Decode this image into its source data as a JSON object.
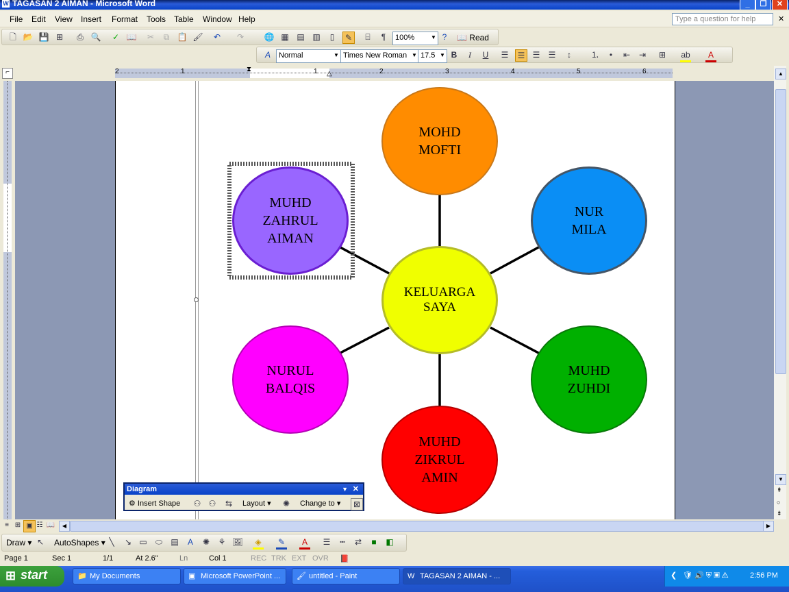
{
  "window": {
    "title": "TAGASAN 2 AIMAN - Microsoft Word"
  },
  "menu": [
    "File",
    "Edit",
    "View",
    "Insert",
    "Format",
    "Tools",
    "Table",
    "Window",
    "Help"
  ],
  "help_placeholder": "Type a question for help",
  "standard_toolbar": {
    "zoom": "100%",
    "read_label": "Read"
  },
  "formatting_toolbar": {
    "style": "Normal",
    "font": "Times New Roman",
    "size": "17.5"
  },
  "ruler_numbers": [
    "2",
    "1",
    "1",
    "2",
    "3",
    "4",
    "5",
    "6"
  ],
  "diagram": {
    "center": "KELUARGA\nSAYA",
    "nodes": [
      {
        "label": "MOHD\nMOFTI",
        "color": "#ff8c00"
      },
      {
        "label": "NUR\nMILA",
        "color": "#0a8ef5"
      },
      {
        "label": "MUHD\nZUHDI",
        "color": "#00b000"
      },
      {
        "label": "MUHD\nZIKRUL\nAMIN",
        "color": "#ff0000"
      },
      {
        "label": "NURUL\nBALQIS",
        "color": "#ff00ff"
      },
      {
        "label": "MUHD\nZAHRUL\nAIMAN",
        "color": "#9966ff"
      }
    ],
    "center_color": "#f0ff00"
  },
  "diagram_toolbar": {
    "title": "Diagram",
    "insert_shape": "Insert Shape",
    "layout": "Layout",
    "change_to": "Change to"
  },
  "draw_toolbar": {
    "draw": "Draw",
    "autoshapes": "AutoShapes"
  },
  "status": {
    "page": "Page 1",
    "sec": "Sec 1",
    "pages": "1/1",
    "at": "At 2.6\"",
    "ln": "Ln",
    "col": "Col 1",
    "rec": "REC",
    "trk": "TRK",
    "ext": "EXT",
    "ovr": "OVR"
  },
  "taskbar": {
    "start": "start",
    "tasks": [
      "My Documents",
      "Microsoft PowerPoint ...",
      "untitled - Paint",
      "TAGASAN 2 AIMAN - ..."
    ],
    "clock": "2:56 PM"
  }
}
